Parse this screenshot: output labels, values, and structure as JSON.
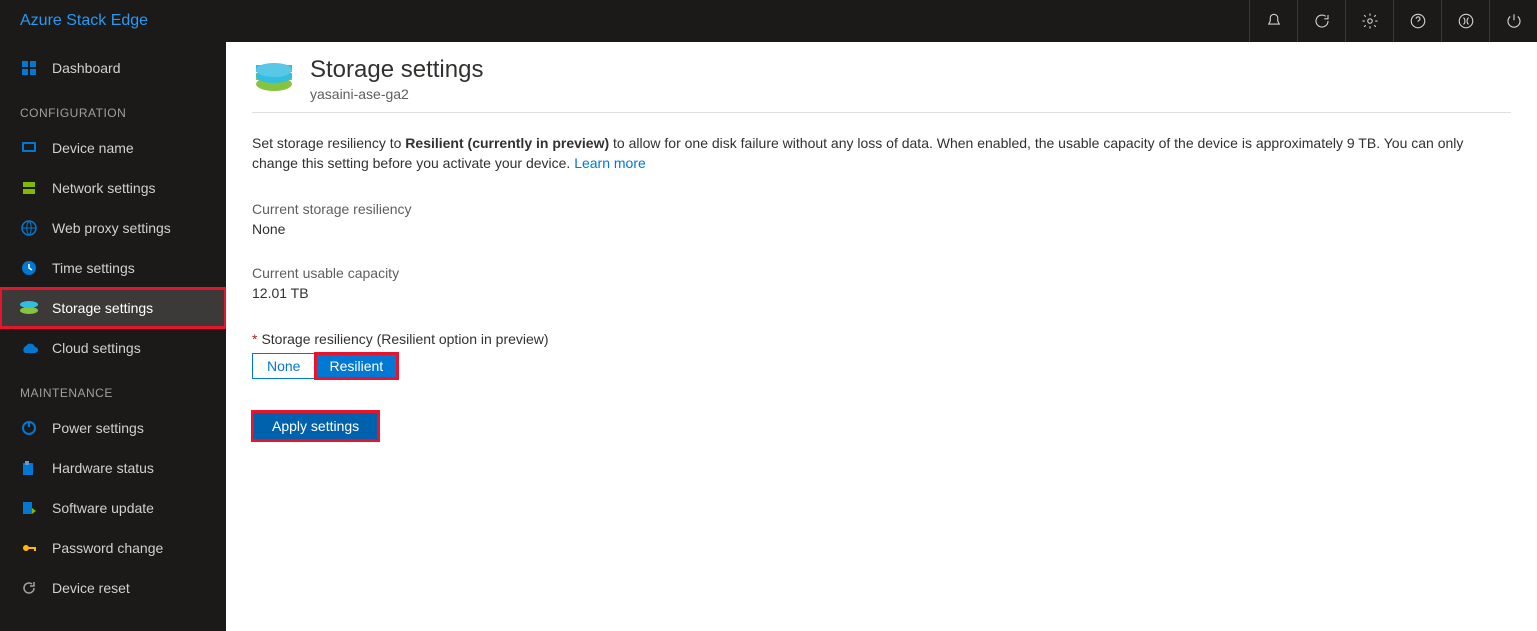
{
  "brand": "Azure Stack Edge",
  "topbar_icons": [
    "notifications-icon",
    "refresh-icon",
    "settings-gear-icon",
    "help-icon",
    "coprocess-icon",
    "power-icon"
  ],
  "sidebar": {
    "dashboard_label": "Dashboard",
    "section_configuration": "CONFIGURATION",
    "section_maintenance": "MAINTENANCE",
    "items_config": [
      {
        "id": "device-name",
        "label": "Device name"
      },
      {
        "id": "network-settings",
        "label": "Network settings"
      },
      {
        "id": "web-proxy-settings",
        "label": "Web proxy settings"
      },
      {
        "id": "time-settings",
        "label": "Time settings"
      },
      {
        "id": "storage-settings",
        "label": "Storage settings",
        "active": true,
        "highlighted": true
      },
      {
        "id": "cloud-settings",
        "label": "Cloud settings"
      }
    ],
    "items_maint": [
      {
        "id": "power-settings",
        "label": "Power settings"
      },
      {
        "id": "hardware-status",
        "label": "Hardware status"
      },
      {
        "id": "software-update",
        "label": "Software update"
      },
      {
        "id": "password-change",
        "label": "Password change"
      },
      {
        "id": "device-reset",
        "label": "Device reset"
      }
    ]
  },
  "page": {
    "title": "Storage settings",
    "subtitle": "yasaini-ase-ga2",
    "description_pre": "Set storage resiliency to ",
    "description_bold": "Resilient (currently in preview)",
    "description_post": " to allow for one disk failure without any loss of data. When enabled, the usable capacity of the device is approximately 9 TB. You can only change this setting before you activate your device. ",
    "learn_more": "Learn more",
    "current_resiliency_label": "Current storage resiliency",
    "current_resiliency_value": "None",
    "current_capacity_label": "Current usable capacity",
    "current_capacity_value": "12.01 TB",
    "form_label": "Storage resiliency (Resilient option in preview)",
    "option_none": "None",
    "option_resilient": "Resilient",
    "selected_option": "Resilient",
    "apply_label": "Apply settings"
  }
}
